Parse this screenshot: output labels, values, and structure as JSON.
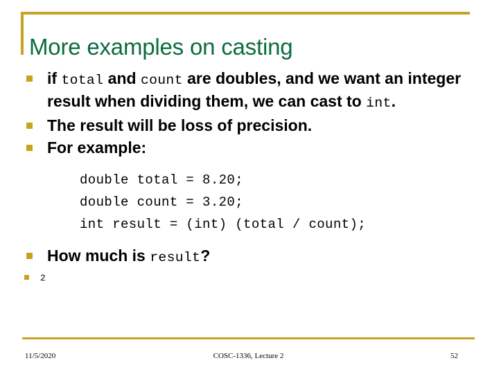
{
  "slide": {
    "title": "More examples on casting",
    "accent_color": "#c8a41e",
    "title_color": "#0c6b3f",
    "body_color": "#000000",
    "background": "#ffffff"
  },
  "bullets": [
    {
      "level": 1,
      "parts": [
        {
          "text": "if ",
          "style": "normal"
        },
        {
          "text": "total",
          "style": "mono"
        },
        {
          "text": " and ",
          "style": "normal"
        },
        {
          "text": "count",
          "style": "mono"
        },
        {
          "text": " are doubles, and we want an integer result when dividing them, we can cast to ",
          "style": "normal"
        },
        {
          "text": "int",
          "style": "mono"
        },
        {
          "text": ".",
          "style": "normal"
        }
      ]
    },
    {
      "level": 1,
      "parts": [
        {
          "text": "The result will be loss of precision.",
          "style": "normal"
        }
      ]
    },
    {
      "level": 1,
      "parts": [
        {
          "text": "For example:",
          "style": "normal"
        }
      ]
    }
  ],
  "code_block": {
    "lines": [
      "double total = 8.20;",
      "double count = 3.20;",
      "int result = (int) (total / count);"
    ]
  },
  "bullets_after_code": [
    {
      "level": 1,
      "parts": [
        {
          "text": "How much is ",
          "style": "normal"
        },
        {
          "text": "result",
          "style": "mono"
        },
        {
          "text": "?",
          "style": "normal"
        }
      ]
    },
    {
      "level": 2,
      "parts": [
        {
          "text": "2",
          "style": "mono"
        }
      ]
    }
  ],
  "footer": {
    "date": "11/5/2020",
    "course": "COSC-1336, Lecture 2",
    "page_number": "52"
  }
}
